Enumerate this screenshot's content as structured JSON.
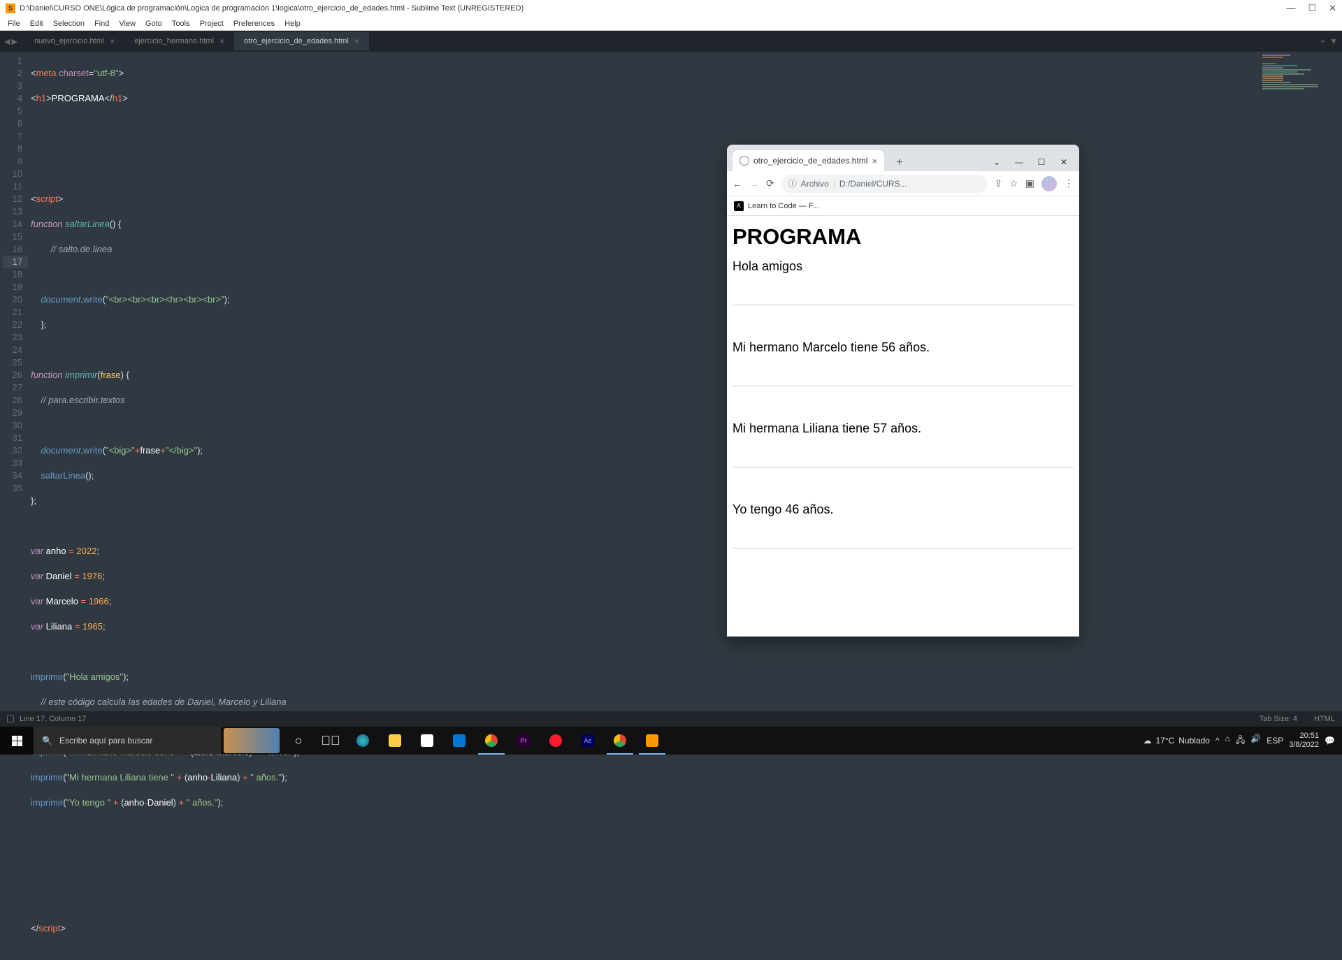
{
  "titlebar": {
    "path": "D:\\Daniel\\CURSO ONE\\Lógica de programación\\Logica de programación 1\\logica\\otro_ejercicio_de_edades.html - Sublime Text (UNREGISTERED)"
  },
  "menu": [
    "File",
    "Edit",
    "Selection",
    "Find",
    "View",
    "Goto",
    "Tools",
    "Project",
    "Preferences",
    "Help"
  ],
  "tabs": [
    {
      "label": "nuevo_ejercicio.html",
      "active": false
    },
    {
      "label": "ejercicio_hermano.html",
      "active": false
    },
    {
      "label": "otro_ejercicio_de_edades.html",
      "active": true
    }
  ],
  "gutter_lines": 35,
  "active_line": 17,
  "statusbar": {
    "left": "Line 17, Column 17",
    "tabsize": "Tab Size: 4",
    "lang": "HTML"
  },
  "browser": {
    "tab_title": "otro_ejercicio_de_edades.html",
    "addr_prefix": "Archivo",
    "addr_path": "D:/Daniel/CURS...",
    "bookmark": "Learn to Code — F...",
    "h1": "PROGRAMA",
    "lines": [
      "Hola amigos",
      "Mi hermano Marcelo tiene 56 años.",
      "Mi hermana Liliana tiene 57 años.",
      "Yo tengo 46 años."
    ]
  },
  "taskbar": {
    "search_placeholder": "Escribe aquí para buscar",
    "weather_temp": "17°C",
    "weather_cond": "Nublado",
    "lang": "ESP",
    "time": "20:51",
    "date": "3/8/2022"
  },
  "code": {
    "l1": {
      "a": "<",
      "b": "meta ",
      "c": "charset",
      "d": "=",
      "e": "\"utf-8\"",
      "f": ">"
    },
    "l2": {
      "a": "<",
      "b": "h1",
      "c": ">",
      "d": "PROGRAMA",
      "e": "</",
      "f": "h1",
      "g": ">"
    },
    "l6": {
      "a": "<",
      "b": "script",
      "c": ">"
    },
    "l7": {
      "a": "function ",
      "b": "saltarLinea",
      "c": "() {"
    },
    "l8": "        // salto.de.linea",
    "l10": {
      "a": "    ",
      "b": "document",
      "c": ".",
      "d": "write",
      "e": "(",
      "f": "\"<br><br><br><hr><br><br>\"",
      "g": ");"
    },
    "l11": "    };",
    "l13": {
      "a": "function ",
      "b": "imprimir",
      "c": "(",
      "d": "frase",
      "e": ") {"
    },
    "l14": "    // para.escribir.textos",
    "l16": {
      "a": "    ",
      "b": "document",
      "c": ".",
      "d": "write",
      "e": "(",
      "f": "\"<big>\"",
      "g": "+",
      "h": "frase",
      "i": "+",
      "j": "\"</big>\"",
      "k": ");"
    },
    "l17": {
      "a": "    ",
      "b": "saltarLinea",
      "c": "();"
    },
    "l18": "};",
    "l20": {
      "a": "var ",
      "b": "anho",
      "c": " = ",
      "d": "2022",
      "e": ";"
    },
    "l21": {
      "a": "var ",
      "b": "Daniel",
      "c": " = ",
      "d": "1976",
      "e": ";"
    },
    "l22": {
      "a": "var ",
      "b": "Marcelo",
      "c": " = ",
      "d": "1966",
      "e": ";"
    },
    "l23": {
      "a": "var ",
      "b": "Liliana",
      "c": " = ",
      "d": "1965",
      "e": ";"
    },
    "l25": {
      "a": "imprimir",
      "b": "(",
      "c": "\"Hola amigos\"",
      "d": ");"
    },
    "l26": "    // este código calcula las edades de Daniel, Marcelo y Liliana",
    "l28": {
      "a": "imprimir",
      "b": "(",
      "c": "\"Mi hermano Marcelo tiene \"",
      "d": " + ",
      "e": "(",
      "f": "anho",
      "g": "-",
      "h": "Marcelo",
      "i": ")",
      "j": " + ",
      "k": "\" años.\"",
      "l": ");"
    },
    "l29": {
      "a": "imprimir",
      "b": "(",
      "c": "\"Mi hermana Liliana tiene \"",
      "d": " + ",
      "e": "(",
      "f": "anho",
      "g": "-",
      "h": "Liliana",
      "i": ")",
      "j": " + ",
      "k": "\" años.\"",
      "l": ");"
    },
    "l30": {
      "a": "imprimir",
      "b": "(",
      "c": "\"Yo tengo \"",
      "d": " + ",
      "e": "(",
      "f": "anho",
      "g": "-",
      "h": "Daniel",
      "i": ")",
      "j": " + ",
      "k": "\" años.\"",
      "l": ");"
    },
    "l35": {
      "a": "</",
      "b": "script",
      "c": ">"
    }
  }
}
